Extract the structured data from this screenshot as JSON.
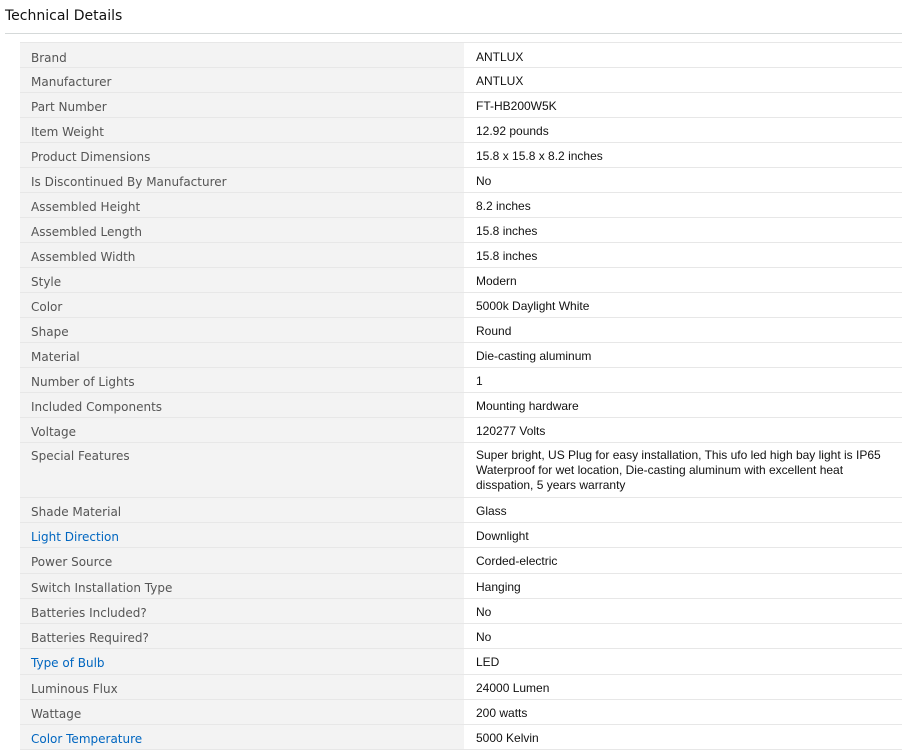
{
  "section": {
    "title": "Technical Details"
  },
  "colors": {
    "key_text": "#555555",
    "link_text": "#0066c0",
    "key_background": "#f3f3f3",
    "border": "#e7e7e7"
  },
  "rows": [
    {
      "label": "Brand",
      "value": "ANTLUX",
      "link": false
    },
    {
      "label": "Manufacturer",
      "value": "ANTLUX",
      "link": false
    },
    {
      "label": "Part Number",
      "value": "FT-HB200W5K",
      "link": false
    },
    {
      "label": "Item Weight",
      "value": "12.92 pounds",
      "link": false
    },
    {
      "label": "Product Dimensions",
      "value": "15.8 x 15.8 x 8.2 inches",
      "link": false
    },
    {
      "label": "Is Discontinued By Manufacturer",
      "value": "No",
      "link": false
    },
    {
      "label": "Assembled Height",
      "value": "8.2 inches",
      "link": false
    },
    {
      "label": "Assembled Length",
      "value": "15.8 inches",
      "link": false
    },
    {
      "label": "Assembled Width",
      "value": "15.8 inches",
      "link": false
    },
    {
      "label": "Style",
      "value": "Modern",
      "link": false
    },
    {
      "label": "Color",
      "value": "5000k Daylight White",
      "link": false
    },
    {
      "label": "Shape",
      "value": "Round",
      "link": false
    },
    {
      "label": "Material",
      "value": "Die-casting aluminum",
      "link": false
    },
    {
      "label": "Number of Lights",
      "value": "1",
      "link": false
    },
    {
      "label": "Included Components",
      "value": "Mounting hardware",
      "link": false
    },
    {
      "label": "Voltage",
      "value": "120277 Volts",
      "link": false
    },
    {
      "label": "Special Features",
      "value": "Super bright, US Plug for easy installation, This ufo led high bay light is IP65 Waterproof for wet location, Die-casting aluminum with excellent heat disspation, 5 years warranty",
      "link": false
    },
    {
      "label": "Shade Material",
      "value": "Glass",
      "link": false
    },
    {
      "label": "Light Direction",
      "value": "Downlight",
      "link": true
    },
    {
      "label": "Power Source",
      "value": "Corded-electric",
      "link": false
    },
    {
      "label": "Switch Installation Type",
      "value": "Hanging",
      "link": false
    },
    {
      "label": "Batteries Included?",
      "value": "No",
      "link": false
    },
    {
      "label": "Batteries Required?",
      "value": "No",
      "link": false
    },
    {
      "label": "Type of Bulb",
      "value": "LED",
      "link": true
    },
    {
      "label": "Luminous Flux",
      "value": "24000 Lumen",
      "link": false
    },
    {
      "label": "Wattage",
      "value": "200 watts",
      "link": false
    },
    {
      "label": "Color Temperature",
      "value": "5000 Kelvin",
      "link": true
    }
  ]
}
